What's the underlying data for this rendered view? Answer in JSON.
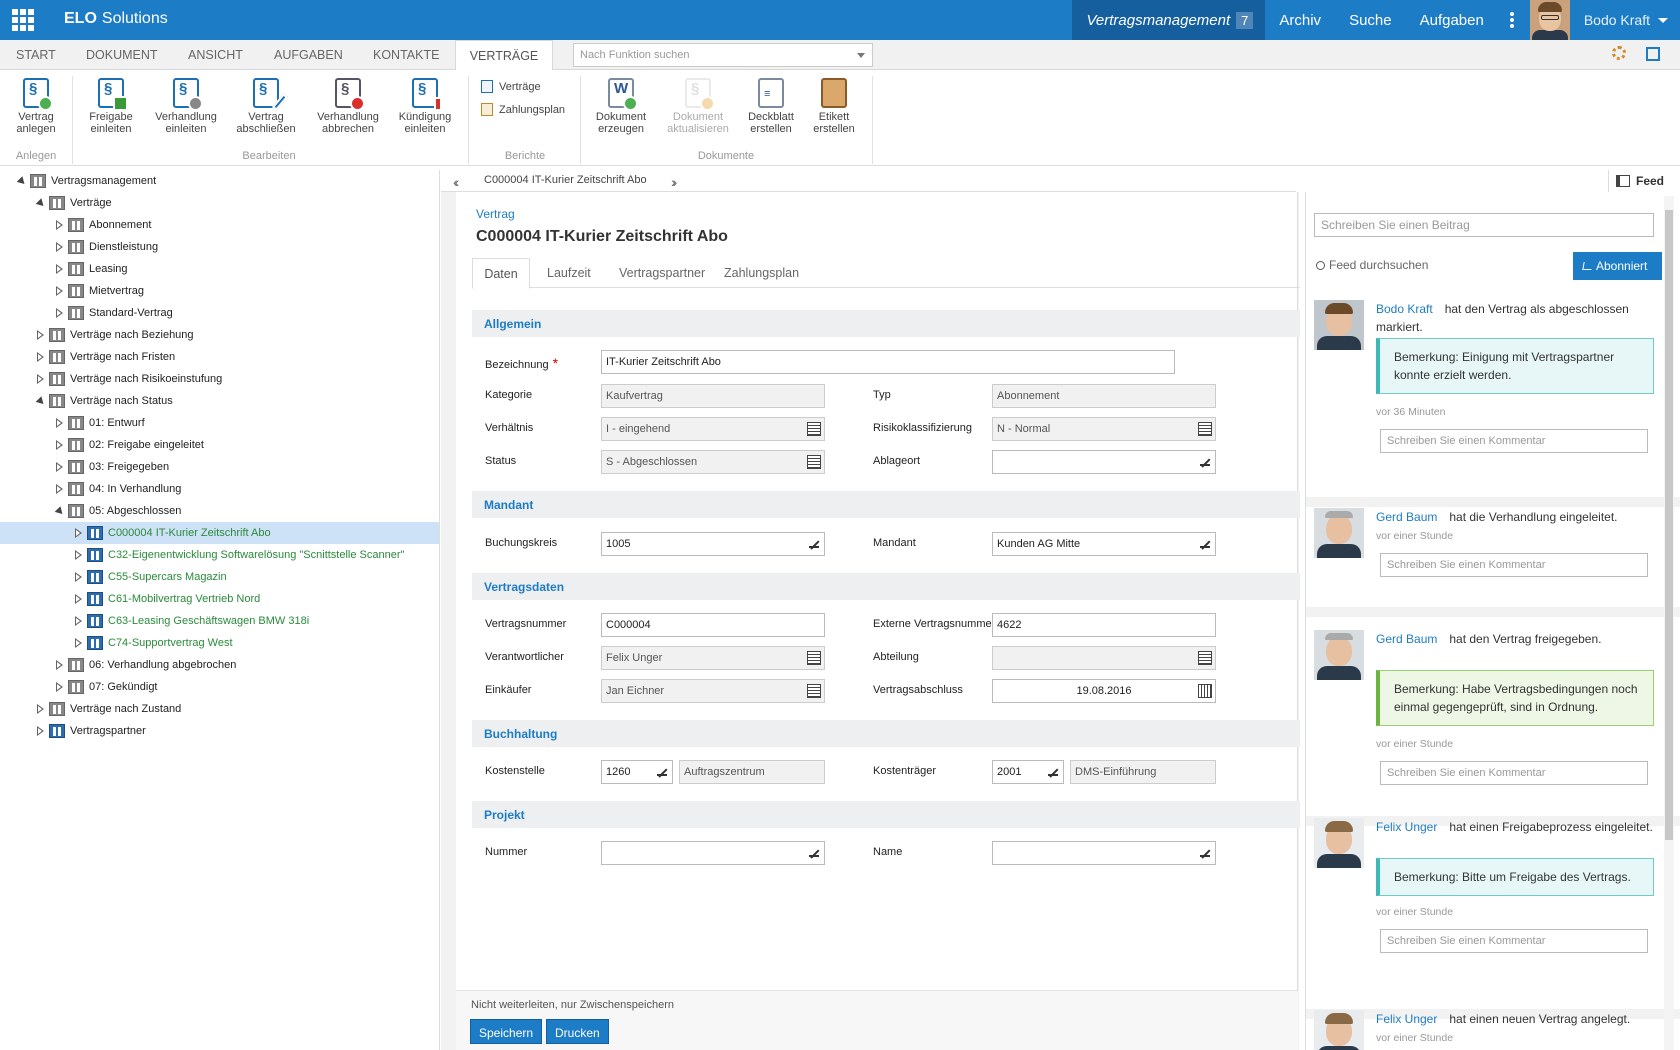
{
  "app": {
    "brand_bold": "ELO",
    "brand_rest": "Solutions"
  },
  "topnav": {
    "active": "Vertragsmanagement",
    "active_count": "7",
    "items": [
      "Archiv",
      "Suche",
      "Aufgaben"
    ],
    "user": "Bodo Kraft"
  },
  "ribbon_tabs": [
    "START",
    "DOKUMENT",
    "ANSICHT",
    "AUFGABEN",
    "KONTAKTE",
    "VERTRÄGE"
  ],
  "function_search_placeholder": "Nach Funktion suchen",
  "ribbon": {
    "anlegen": {
      "group": "Anlegen",
      "buttons": [
        {
          "l1": "Vertrag",
          "l2": "anlegen"
        }
      ]
    },
    "bearbeiten": {
      "group": "Bearbeiten",
      "buttons": [
        {
          "l1": "Freigabe",
          "l2": "einleiten"
        },
        {
          "l1": "Verhandlung",
          "l2": "einleiten"
        },
        {
          "l1": "Vertrag",
          "l2": "abschließen"
        },
        {
          "l1": "Verhandlung",
          "l2": "abbrechen"
        },
        {
          "l1": "Kündigung",
          "l2": "einleiten"
        }
      ]
    },
    "berichte": {
      "group": "Berichte",
      "items": [
        "Verträge",
        "Zahlungsplan"
      ]
    },
    "dokumente": {
      "group": "Dokumente",
      "buttons": [
        {
          "l1": "Dokument",
          "l2": "erzeugen"
        },
        {
          "l1": "Dokument",
          "l2": "aktualisieren"
        },
        {
          "l1": "Deckblatt",
          "l2": "erstellen"
        },
        {
          "l1": "Etikett",
          "l2": "erstellen"
        }
      ]
    }
  },
  "tree": [
    {
      "label": "Vertragsmanagement",
      "level": 0,
      "state": "open",
      "icon": "cabinet"
    },
    {
      "label": "Verträge",
      "level": 1,
      "state": "open",
      "icon": "cabinet"
    },
    {
      "label": "Abonnement",
      "level": 2,
      "state": "closed",
      "icon": "folder"
    },
    {
      "label": "Dienstleistung",
      "level": 2,
      "state": "closed",
      "icon": "folder"
    },
    {
      "label": "Leasing",
      "level": 2,
      "state": "closed",
      "icon": "folder"
    },
    {
      "label": "Mietvertrag",
      "level": 2,
      "state": "closed",
      "icon": "folder"
    },
    {
      "label": "Standard-Vertrag",
      "level": 2,
      "state": "closed",
      "icon": "folder"
    },
    {
      "label": "Verträge nach Beziehung",
      "level": 1,
      "state": "closed",
      "icon": "folder"
    },
    {
      "label": "Verträge nach Fristen",
      "level": 1,
      "state": "closed",
      "icon": "folder"
    },
    {
      "label": "Verträge nach Risikoeinstufung",
      "level": 1,
      "state": "closed",
      "icon": "folder"
    },
    {
      "label": "Verträge nach Status",
      "level": 1,
      "state": "open",
      "icon": "folder"
    },
    {
      "label": "01: Entwurf",
      "level": 2,
      "state": "closed",
      "icon": "folder"
    },
    {
      "label": "02: Freigabe eingeleitet",
      "level": 2,
      "state": "closed",
      "icon": "folder"
    },
    {
      "label": "03: Freigegeben",
      "level": 2,
      "state": "closed",
      "icon": "folder"
    },
    {
      "label": "04: In Verhandlung",
      "level": 2,
      "state": "closed",
      "icon": "folder"
    },
    {
      "label": "05: Abgeschlossen",
      "level": 2,
      "state": "open",
      "icon": "folder"
    },
    {
      "label": "C000004 IT-Kurier Zeitschrift Abo",
      "level": 3,
      "state": "closed",
      "icon": "doc",
      "green": true,
      "selected": true
    },
    {
      "label": "C32-Eigenentwicklung Softwarelösung \"Scnittstelle Scanner\"",
      "level": 3,
      "state": "closed",
      "icon": "doc",
      "green": true
    },
    {
      "label": "C55-Supercars Magazin",
      "level": 3,
      "state": "closed",
      "icon": "doc",
      "green": true
    },
    {
      "label": "C61-Mobilvertrag Vertrieb Nord",
      "level": 3,
      "state": "closed",
      "icon": "doc",
      "green": true
    },
    {
      "label": "C63-Leasing Geschäftswagen BMW 318i",
      "level": 3,
      "state": "closed",
      "icon": "doc",
      "green": true
    },
    {
      "label": "C74-Supportvertrag West",
      "level": 3,
      "state": "closed",
      "icon": "doc",
      "green": true
    },
    {
      "label": "06: Verhandlung abgebrochen",
      "level": 2,
      "state": "closed",
      "icon": "folder"
    },
    {
      "label": "07: Gekündigt",
      "level": 2,
      "state": "closed",
      "icon": "folder"
    },
    {
      "label": "Verträge nach Zustand",
      "level": 1,
      "state": "closed",
      "icon": "folder"
    },
    {
      "label": "Vertragspartner",
      "level": 1,
      "state": "closed",
      "icon": "partner"
    }
  ],
  "panel_header": {
    "title": "C000004 IT-Kurier Zeitschrift Abo",
    "feed": "Feed"
  },
  "form": {
    "breadcrumb": "Vertrag",
    "title": "C000004 IT-Kurier Zeitschrift Abo",
    "tabs": [
      "Daten",
      "Laufzeit",
      "Vertragspartner",
      "Zahlungsplan"
    ],
    "sections": {
      "allgemein": "Allgemein",
      "mandant": "Mandant",
      "vertragsdaten": "Vertragsdaten",
      "buchhaltung": "Buchhaltung",
      "projekt": "Projekt"
    },
    "fields": {
      "bezeichnung": {
        "label": "Bezeichnung",
        "value": "IT-Kurier Zeitschrift Abo"
      },
      "kategorie": {
        "label": "Kategorie",
        "value": "Kaufvertrag"
      },
      "typ": {
        "label": "Typ",
        "value": "Abonnement"
      },
      "verhaeltnis": {
        "label": "Verhältnis",
        "value": "I - eingehend"
      },
      "risiko": {
        "label": "Risikoklassifizierung",
        "value": "N - Normal"
      },
      "status": {
        "label": "Status",
        "value": "S - Abgeschlossen"
      },
      "ablageort": {
        "label": "Ablageort",
        "value": ""
      },
      "buchungskreis": {
        "label": "Buchungskreis",
        "value": "1005"
      },
      "mandant": {
        "label": "Mandant",
        "value": "Kunden AG Mitte"
      },
      "vertragsnummer": {
        "label": "Vertragsnummer",
        "value": "C000004"
      },
      "extnummer": {
        "label": "Externe Vertragsnummer",
        "value": "4622"
      },
      "verantwortlicher": {
        "label": "Verantwortlicher",
        "value": "Felix Unger"
      },
      "abteilung": {
        "label": "Abteilung",
        "value": ""
      },
      "einkaeufer": {
        "label": "Einkäufer",
        "value": "Jan Eichner"
      },
      "abschluss": {
        "label": "Vertragsabschluss",
        "value": "19.08.2016"
      },
      "kostenstelle": {
        "label": "Kostenstelle",
        "value": "1260",
        "desc": "Auftragszentrum"
      },
      "kostentraeger": {
        "label": "Kostenträger",
        "value": "2001",
        "desc": "DMS-Einführung"
      },
      "nummer": {
        "label": "Nummer",
        "value": ""
      },
      "name": {
        "label": "Name",
        "value": ""
      }
    },
    "footer_note": "Nicht weiterleiten, nur Zwischenspeichern",
    "save": "Speichern",
    "print": "Drucken"
  },
  "feed": {
    "input_placeholder": "Schreiben Sie einen Beitrag",
    "search": "Feed durchsuchen",
    "subscribed": "Abonniert",
    "comment_placeholder": "Schreiben Sie einen Kommentar",
    "entries": [
      {
        "name": "Bodo Kraft",
        "text": "hat den Vertrag als abgeschlossen markiert.",
        "remark": "Bemerkung: Einigung mit Vertragspartner konnte erzielt werden.",
        "time": "vor 36 Minuten"
      },
      {
        "name": "Gerd Baum",
        "text": "hat die Verhandlung eingeleitet.",
        "time": "vor einer Stunde"
      },
      {
        "name": "Gerd Baum",
        "text": "hat den Vertrag freigegeben.",
        "remark": "Bemerkung: Habe Vertragsbedingungen noch einmal gegengeprüft, sind in Ordnung.",
        "time": "vor einer Stunde"
      },
      {
        "name": "Felix Unger",
        "text": "hat einen Freigabeprozess eingeleitet.",
        "remark": "Bemerkung: Bitte um Freigabe des Vertrags.",
        "time": "vor einer Stunde"
      },
      {
        "name": "Felix Unger",
        "text": "hat einen neuen Vertrag angelegt.",
        "time": "vor einer Stunde"
      }
    ]
  }
}
